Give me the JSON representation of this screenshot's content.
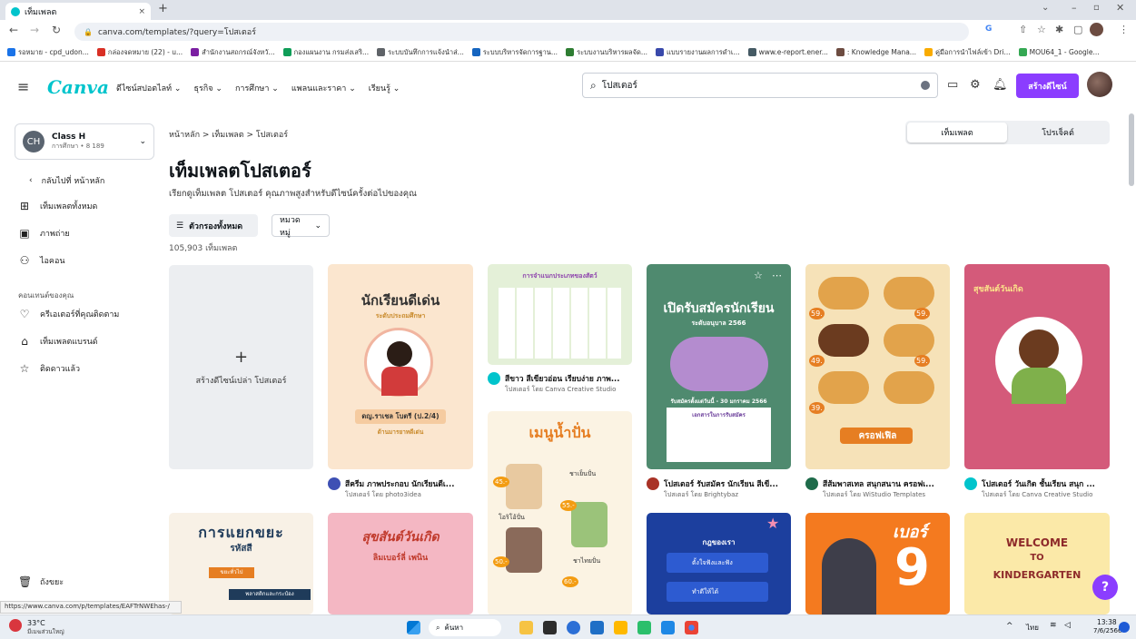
{
  "browser": {
    "tab_title": "เท็มเพลต",
    "url": "canva.com/templates/?query=โปสเตอร์",
    "bookmarks": [
      "รอหมาย - cpd_udon...",
      "กล่องจดหมาย (22) - u...",
      "สำนักงานสถกรณ์จังหวั...",
      "กองแผนงาน กรมส่งเสริ...",
      "ระบบบันทึกการแจ้งนำส่...",
      "ระบบบริหารจัดการฐาน...",
      "ระบบงานบริหารผลจัด...",
      "แบบรายงานผลการดำเ...",
      "www.e-report.ener...",
      ": Knowledge Mana...",
      "คู่มือการนำไฟล์เข้า Dri...",
      "MOU64_1 - Google..."
    ]
  },
  "header": {
    "logo": "Canva",
    "nav": [
      "ดีไซน์สปอตไลท์",
      "ธุรกิจ",
      "การศึกษา",
      "แพลนและราคา",
      "เรียนรู้"
    ],
    "search_value": "โปสเตอร์",
    "create_label": "สร้างดีไซน์"
  },
  "sidebar": {
    "team_name": "Class H",
    "team_sub": "การศึกษา • 8 189",
    "team_initials": "CH",
    "back_label": "กลับไปที่ หน้าหลัก",
    "items": [
      {
        "label": "เท็มเพลตทั้งหมด",
        "icon": "template-icon"
      },
      {
        "label": "ภาพถ่าย",
        "icon": "photo-icon"
      },
      {
        "label": "ไอคอน",
        "icon": "icons-icon"
      }
    ],
    "section_label": "คอนเทนต์ของคุณ",
    "section_items": [
      {
        "label": "ครีเอเตอร์ที่คุณติดตาม",
        "icon": "heart-icon"
      },
      {
        "label": "เท็มเพลตแบรนด์",
        "icon": "brand-icon"
      },
      {
        "label": "ติดดาวแล้ว",
        "icon": "star-icon"
      }
    ],
    "trash_label": "ถังขยะ"
  },
  "main": {
    "breadcrumb": "หน้าหลัก  >  เท็มเพลต  >  โปสเตอร์",
    "title": "เท็มเพลตโปสเตอร์",
    "description": "เรียกดูเท็มเพลต โปสเตอร์ คุณภาพสูงสำหรับดีไซน์ครั้งต่อไปของคุณ",
    "filter_label": "ตัวกรองทั้งหมด",
    "category_label": "หมวดหมู่",
    "count": "105,903 เท็มเพลต",
    "toggle": [
      "เท็มเพลต",
      "โปรเจ็คต์"
    ],
    "blank_label": "สร้างดีไซน์เปล่า โปสเตอร์",
    "blank_plus": "+"
  },
  "cards": [
    {
      "title": "สีครีม ภาพประกอบ นักเรียนดีเ...",
      "sub": "โปสเตอร์ โดย photo3idea",
      "poster": "นักเรียนดีเด่น",
      "poster_sub": "ระดับประถมศึกษา",
      "poster_name": "ดญ.ราเชล โบตรี (ป.2/4)",
      "poster_room": "ด้านมารยาทดีเด่น",
      "color": "#fbe6cf"
    },
    {
      "title": "สีขาว สีเขียวอ่อน เรียบง่าย ภาพ...",
      "sub": "โปสเตอร์ โดย Canva Creative Studio",
      "poster": "การจำแนกประเภทของสัตว์",
      "color": "#e4f0d8"
    },
    {
      "title": "โปสเตอร์ รับสมัคร นักเรียน สีเขี...",
      "sub": "โปสเตอร์ โดย Brightybaz",
      "poster": "เปิดรับสมัครนักเรียน",
      "poster_sub": "ระดับอนุบาล 2566",
      "poster_date": "รับสมัครตั้งแต่วันนี้ - 30 มกราคม 2566",
      "poster_doc": "เอกสารในการรับสมัคร",
      "color": "#4f8a6f"
    },
    {
      "title": "สีส้มพาสเทล สนุกสนาน ครอฟเ...",
      "sub": "โปสเตอร์ โดย WiStudio Templates",
      "poster": "ครอฟเฟิล",
      "prices": [
        "59.",
        "59.",
        "49.",
        "59.",
        "39."
      ],
      "color": "#f6e2b8"
    },
    {
      "title": "โปสเตอร์ วันเกิด ชั้นเรียน สนุก ...",
      "sub": "โปสเตอร์ โดย Canva Creative Studio",
      "poster": "สุขสันต์วันเกิด",
      "color": "#d45a7a"
    },
    {
      "poster": "เมนูน้ำปั่น",
      "poster_sub": "ชาเย็นปั่น",
      "poster_b": "โอริโอ้ปั่น",
      "poster_c": "ชาไทยปั่น",
      "prices": [
        "45.-",
        "55.-",
        "50.-",
        "60.-"
      ],
      "color": "#fbf3e3"
    },
    {
      "poster": "การแยกขยะ",
      "poster_sub": "รหัสสี",
      "tags": [
        "ขยะทั่วไป",
        "พลาสติกและกระป๋อง"
      ],
      "color": "#f8f1e6"
    },
    {
      "poster": "สุขสันต์วันเกิด",
      "poster_sub": "ลิมเบอร์ลี่ เพนิน",
      "color": "#f4b7c3"
    },
    {
      "poster": "กฎของเรา",
      "items": [
        "ตั้งใจฟังและฟัง",
        "ทำดีให้ได้"
      ],
      "color": "#1c3f9e"
    },
    {
      "poster": "เบอร์",
      "number": "9",
      "color": "#f47a1f"
    },
    {
      "poster": "WELCOME",
      "poster_b": "TO",
      "poster_c": "KINDERGARTEN",
      "color": "#fbe9a8"
    }
  ],
  "status_url": "https://www.canva.com/p/templates/EAFTrNWEhas-/",
  "taskbar": {
    "weather": "33°C",
    "weather_sub": "มีเมฆส่วนใหญ่",
    "search": "ค้นหา",
    "time": "13:38",
    "date": "7/6/2566",
    "lang": "ไทย"
  },
  "colors": {
    "accent": "#8b3dff",
    "logo": "#00c4cc"
  }
}
